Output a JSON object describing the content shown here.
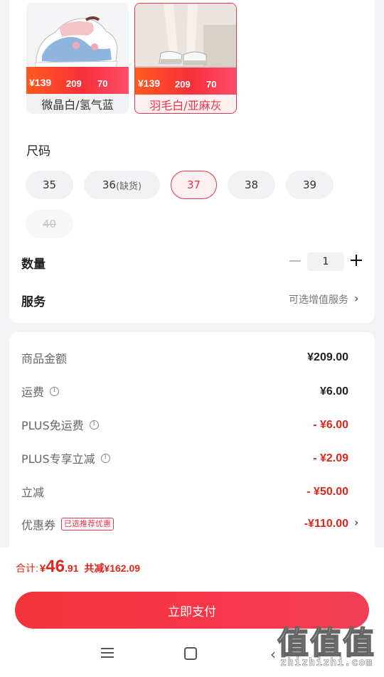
{
  "colors": {
    "accent": "#e8334a",
    "price_red": "#e1251b",
    "chip_bg": "#f2f2f4",
    "pay_button": "#f2353b"
  },
  "variants": [
    {
      "name": "微晶白/氢气蓝",
      "price": "¥139",
      "price2": "209",
      "price3": "70",
      "selected": false
    },
    {
      "name": "羽毛白/亚麻灰",
      "price": "¥139",
      "price2": "209",
      "price3": "70",
      "selected": true
    }
  ],
  "size": {
    "title": "尺码",
    "options": [
      {
        "label": "35",
        "state": "normal"
      },
      {
        "label": "36",
        "note": "(缺货)",
        "state": "normal"
      },
      {
        "label": "37",
        "state": "selected"
      },
      {
        "label": "38",
        "state": "normal"
      },
      {
        "label": "39",
        "state": "normal"
      },
      {
        "label": "40",
        "state": "disabled"
      }
    ]
  },
  "quantity": {
    "label": "数量",
    "value": "1",
    "minus_icon": "minus-icon",
    "plus_icon": "plus-icon"
  },
  "service": {
    "label": "服务",
    "value": "可选增值服务",
    "chevron_icon": "chevron-right-icon"
  },
  "fees": {
    "goods": {
      "label": "商品金额",
      "value": "¥209.00"
    },
    "shipping": {
      "label": "运费",
      "value": "¥6.00",
      "icon": "info-icon"
    },
    "plus_shipping": {
      "label": "PLUS免运费",
      "value": "- ¥6.00",
      "icon": "info-icon"
    },
    "plus_discount": {
      "label": "PLUS专享立减",
      "value": "- ¥2.09",
      "icon": "info-icon"
    },
    "instant_discount": {
      "label": "立减",
      "value": "- ¥50.00"
    },
    "coupon": {
      "label": "优惠券",
      "badge": "已选推荐优惠",
      "value": "-¥110.00"
    }
  },
  "total": {
    "label": "合计:",
    "yen": "¥",
    "integer": "46",
    "decimal": ".91",
    "saved": "共减¥162.09"
  },
  "pay_button": {
    "label": "立即支付"
  },
  "nav": {
    "menu_icon": "menu-icon",
    "home_icon": "home-icon",
    "back_icon": "back-icon"
  },
  "watermark": {
    "chars": [
      "值",
      "值",
      "值"
    ],
    "url": "zhizhizhi.com"
  }
}
